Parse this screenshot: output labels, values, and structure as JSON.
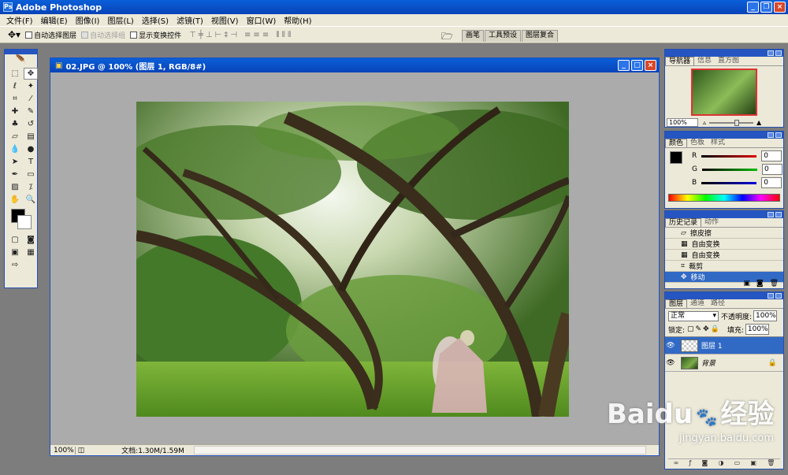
{
  "app": {
    "title": "Adobe Photoshop"
  },
  "menu": [
    "文件(F)",
    "编辑(E)",
    "图像(I)",
    "图层(L)",
    "选择(S)",
    "滤镜(T)",
    "视图(V)",
    "窗口(W)",
    "帮助(H)"
  ],
  "options": {
    "auto_select_layer": "自动选择图层",
    "auto_select_group": "自动选择组",
    "show_transform": "显示变换控件"
  },
  "palette_well": [
    "画笔",
    "工具预设",
    "图层复合"
  ],
  "document": {
    "title": "02.JPG @ 100% (图层 1, RGB/8#)",
    "zoom": "100%",
    "doc_info": "文档:1.30M/1.59M"
  },
  "navigator": {
    "tabs": [
      "导航器",
      "信息",
      "直方图"
    ],
    "zoom": "100%"
  },
  "color": {
    "tabs": [
      "颜色",
      "色板",
      "样式"
    ],
    "r_label": "R",
    "g_label": "G",
    "b_label": "B",
    "r": "0",
    "g": "0",
    "b": "0",
    "accent_r": "#cc0000",
    "accent_g": "#00a000",
    "accent_b": "#0000cc"
  },
  "history": {
    "tabs": [
      "历史记录",
      "动作"
    ],
    "items": [
      "擦皮擦",
      "自由变换",
      "自由变换",
      "裁剪",
      "移动"
    ]
  },
  "layers": {
    "tabs": [
      "图层",
      "通道",
      "路径"
    ],
    "blend": "正常",
    "opacity_label": "不透明度:",
    "opacity": "100%",
    "lock_label": "锁定:",
    "fill_label": "填充:",
    "fill": "100%",
    "items": [
      "图层 1",
      "背景"
    ]
  },
  "watermark": {
    "brand": "Baidu",
    "cn": "经验",
    "url": "jingyan.baidu.com"
  }
}
